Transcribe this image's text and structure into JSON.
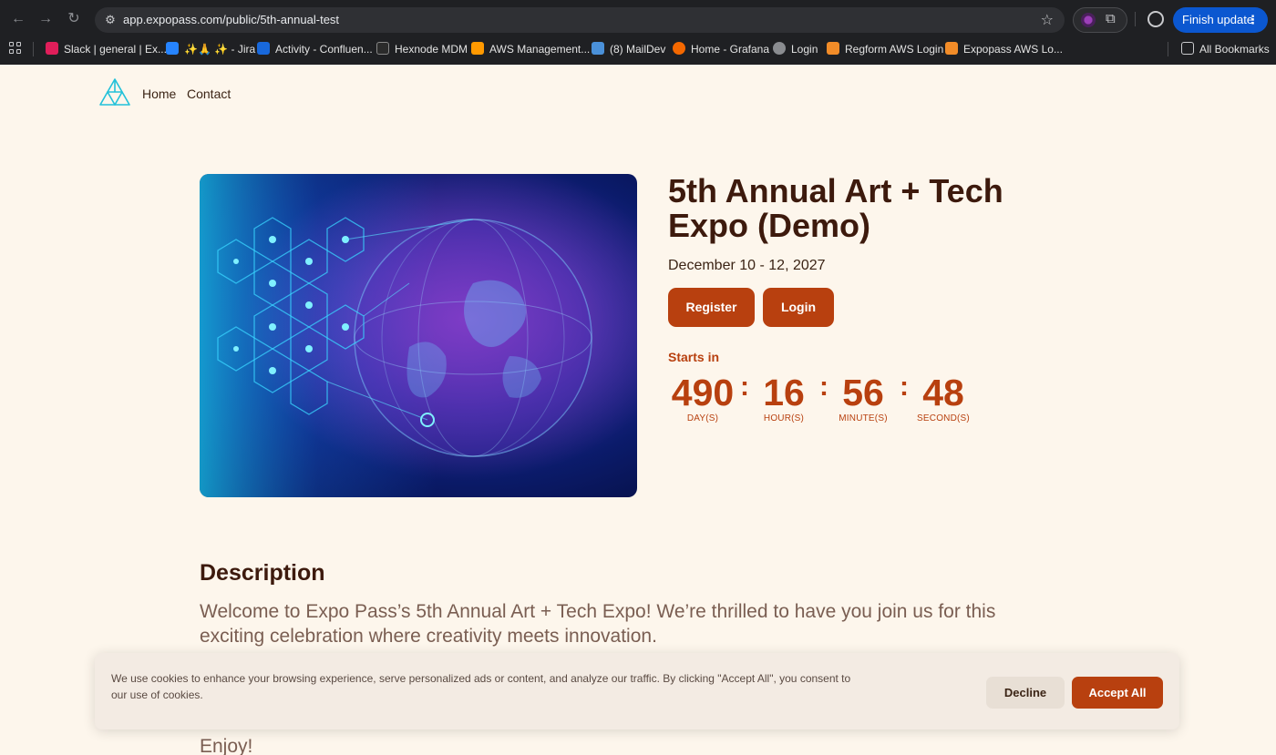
{
  "browser": {
    "url_host": "app.expopass.com",
    "url_path": "/public/5th-annual-test",
    "finish_update_label": "Finish update",
    "bookmarks": [
      {
        "label": "Slack | general | Ex...",
        "color": "#e01e5a"
      },
      {
        "label": "✨🙏 ✨ - Jira",
        "color": "#2684ff"
      },
      {
        "label": "Activity - Confluen...",
        "color": "#1868db"
      },
      {
        "label": "Hexnode MDM",
        "color": "#2b2b2b"
      },
      {
        "label": "AWS Management...",
        "color": "#ff9900"
      },
      {
        "label": "(8) MailDev",
        "color": "#4a90d9"
      },
      {
        "label": "Home - Grafana",
        "color": "#f46800"
      },
      {
        "label": "Login",
        "color": "#8a8c90"
      },
      {
        "label": "Regform AWS Login",
        "color": "#f28c28"
      },
      {
        "label": "Expopass AWS Lo...",
        "color": "#f28c28"
      }
    ],
    "all_bookmarks_label": "All Bookmarks"
  },
  "site": {
    "nav": {
      "home": "Home",
      "contact": "Contact"
    },
    "accent": "#b8400f"
  },
  "event": {
    "title": "5th Annual Art + Tech Expo (Demo)",
    "dates": "December 10 - 12, 2027",
    "register_label": "Register",
    "login_label": "Login",
    "starts_in_label": "Starts in",
    "countdown": [
      {
        "value": "490",
        "unit": "DAY(S)"
      },
      {
        "value": "16",
        "unit": "HOUR(S)"
      },
      {
        "value": "56",
        "unit": "MINUTE(S)"
      },
      {
        "value": "48",
        "unit": "SECOND(S)"
      }
    ]
  },
  "description": {
    "heading": "Description",
    "text": "Welcome to Expo Pass’s 5th Annual Art + Tech Expo! We’re thrilled to have you join us for this exciting celebration where creativity meets innovation.",
    "closing": "Enjoy!"
  },
  "cookie_banner": {
    "text": "We use cookies to enhance your browsing experience, serve personalized ads or content, and analyze our traffic. By clicking \"Accept All\", you consent to our use of cookies.",
    "decline_label": "Decline",
    "accept_label": "Accept All"
  }
}
